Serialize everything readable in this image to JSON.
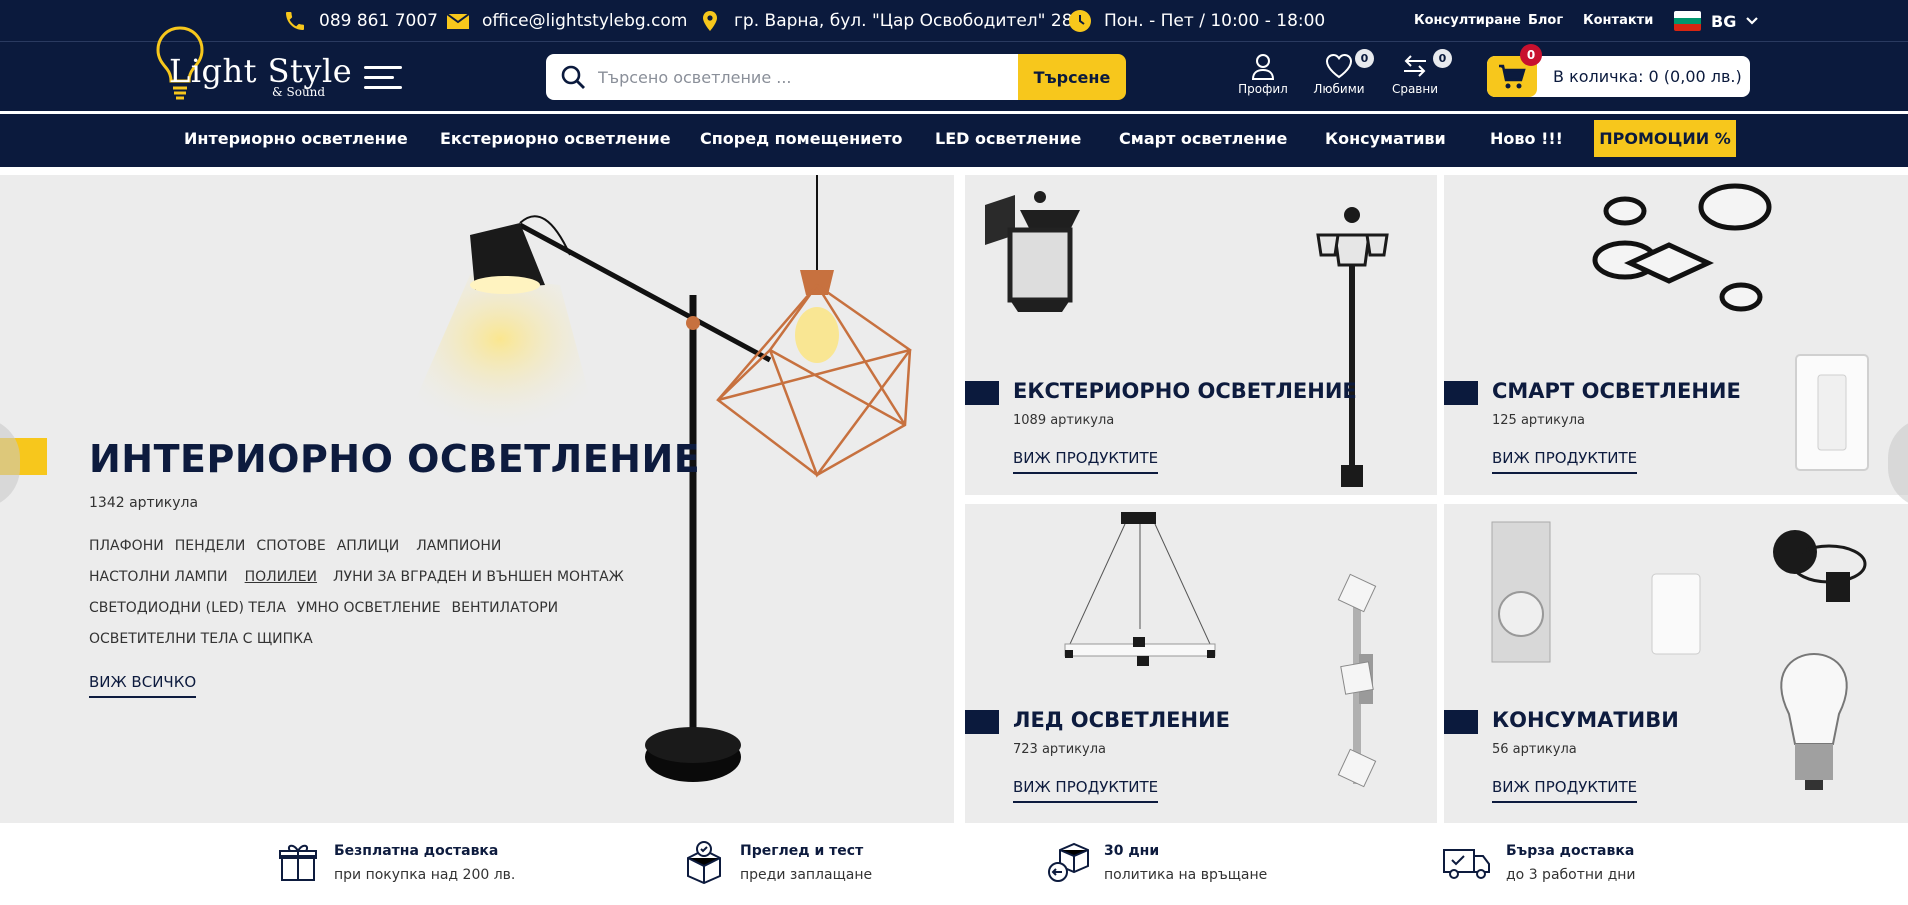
{
  "topbar": {
    "phone": "089 861 7007",
    "email": "office@lightstylebg.com",
    "address": "гр. Варна, бул. \"Цар Освободител\" 289",
    "hours": "Пон. - Пет / 10:00 - 18:00",
    "links": [
      "Консултиране",
      "Блог",
      "Контакти"
    ],
    "language": "BG"
  },
  "header": {
    "logo_text": "Light Style",
    "logo_sub": "& Sound",
    "search_placeholder": "Търсено осветление ...",
    "search_button": "Търсене",
    "profile_label": "Профил",
    "favorites_label": "Любими",
    "favorites_count": "0",
    "compare_label": "Сравни",
    "compare_count": "0",
    "cart_count": "0",
    "cart_text": "В количка: 0 (0,00 лв.)"
  },
  "nav": {
    "items": [
      "Интериорно осветление",
      "Екстериорно осветление",
      "Според помещението",
      "LED осветление",
      "Смарт осветление",
      "Консумативи",
      "Ново !!!"
    ],
    "promo": "ПРОМОЦИИ %"
  },
  "hero": {
    "title": "ИНТЕРИОРНО ОСВЕТЛЕНИЕ",
    "count": "1342 артикула",
    "links": [
      [
        "ПЛАФОНИ",
        "ПЕНДЕЛИ",
        "СПОТОВЕ",
        "АПЛИЦИ",
        "ЛАМПИОНИ"
      ],
      [
        "НАСТОЛНИ ЛАМПИ",
        "ПОЛИЛЕИ",
        "ЛУНИ ЗА ВГРАДЕН И ВЪНШЕН МОНТАЖ"
      ],
      [
        "СВЕТОДИОДНИ (LED) ТЕЛА",
        "УМНО ОСВЕТЛЕНИЕ",
        "ВЕНТИЛАТОРИ"
      ],
      [
        "ОСВЕТИТЕЛНИ ТЕЛА С ЩИПКА"
      ]
    ],
    "see_all": "ВИЖ ВСИЧКО"
  },
  "cards": [
    {
      "title": "ЕКСТЕРИОРНО ОСВЕТЛЕНИЕ",
      "count": "1089 артикула",
      "cta": "ВИЖ ПРОДУКТИТЕ"
    },
    {
      "title": "СМАРТ ОСВЕТЛЕНИЕ",
      "count": "125 артикула",
      "cta": "ВИЖ ПРОДУКТИТЕ"
    },
    {
      "title": "ЛЕД ОСВЕТЛЕНИЕ",
      "count": "723 артикула",
      "cta": "ВИЖ ПРОДУКТИТЕ"
    },
    {
      "title": "КОНСУМАТИВИ",
      "count": "56 артикула",
      "cta": "ВИЖ ПРОДУКТИТЕ"
    }
  ],
  "features": [
    {
      "title": "Безплатна доставка",
      "text": "при покупка над 200 лв.",
      "icon": "gift-icon"
    },
    {
      "title": "Преглед и тест",
      "text": "преди заплащане",
      "icon": "box-check-icon"
    },
    {
      "title": "30 дни",
      "text": "политика на връщане",
      "icon": "return-box-icon"
    },
    {
      "title": "Бърза доставка",
      "text": "до 3 работни дни",
      "icon": "truck-icon"
    }
  ],
  "colors": {
    "navy": "#0b1a3d",
    "accent_yellow": "#f7c71c",
    "badge_red": "#c8102e",
    "panel_gray": "#ececec"
  }
}
